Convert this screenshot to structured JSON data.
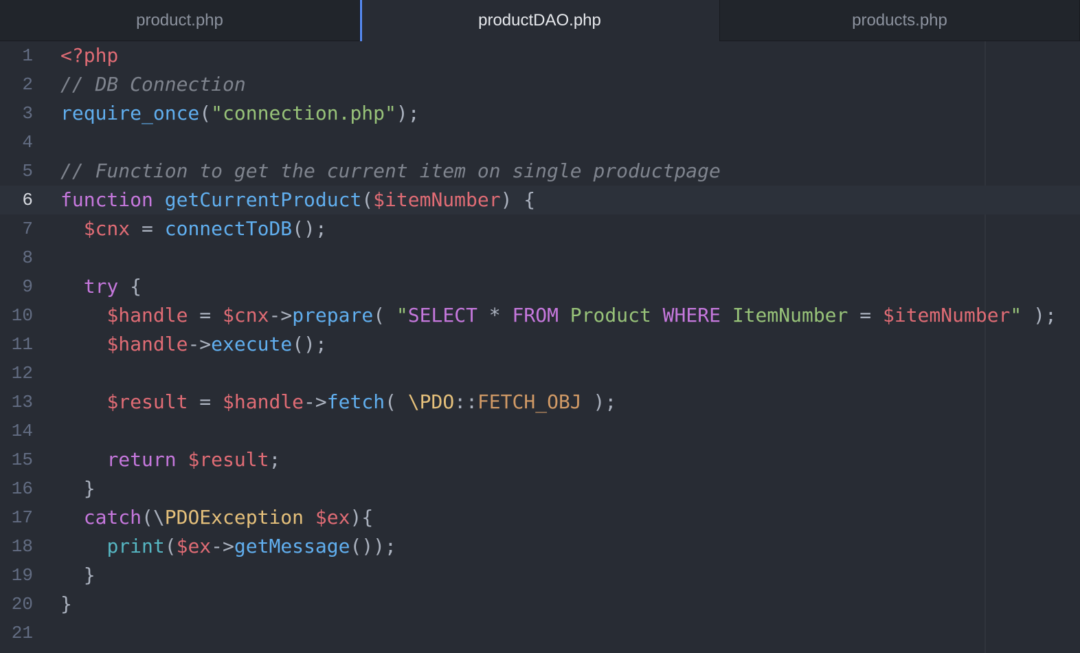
{
  "tabs": [
    {
      "label": "product.php",
      "active": false
    },
    {
      "label": "productDAO.php",
      "active": true
    },
    {
      "label": "products.php",
      "active": false
    }
  ],
  "editor": {
    "cursor_line": 6,
    "lines": [
      {
        "n": "1",
        "tokens": [
          {
            "t": "<?php",
            "c": "tag"
          }
        ]
      },
      {
        "n": "2",
        "tokens": [
          {
            "t": "// DB Connection",
            "c": "comment"
          }
        ]
      },
      {
        "n": "3",
        "tokens": [
          {
            "t": "require_once",
            "c": "func"
          },
          {
            "t": "(",
            "c": "plain"
          },
          {
            "t": "\"connection.php\"",
            "c": "string"
          },
          {
            "t": ");",
            "c": "plain"
          }
        ]
      },
      {
        "n": "4",
        "tokens": []
      },
      {
        "n": "5",
        "tokens": [
          {
            "t": "// Function to get the current item on single productpage",
            "c": "comment"
          }
        ]
      },
      {
        "n": "6",
        "tokens": [
          {
            "t": "function",
            "c": "keyword"
          },
          {
            "t": " ",
            "c": "plain"
          },
          {
            "t": "getCurrentProduct",
            "c": "func"
          },
          {
            "t": "(",
            "c": "plain"
          },
          {
            "t": "$itemNumber",
            "c": "var"
          },
          {
            "t": ") {",
            "c": "plain"
          }
        ]
      },
      {
        "n": "7",
        "tokens": [
          {
            "t": "  ",
            "c": "plain"
          },
          {
            "t": "$cnx",
            "c": "var"
          },
          {
            "t": " = ",
            "c": "plain"
          },
          {
            "t": "connectToDB",
            "c": "func"
          },
          {
            "t": "();",
            "c": "plain"
          }
        ]
      },
      {
        "n": "8",
        "tokens": []
      },
      {
        "n": "9",
        "tokens": [
          {
            "t": "  ",
            "c": "plain"
          },
          {
            "t": "try",
            "c": "keyword"
          },
          {
            "t": " {",
            "c": "plain"
          }
        ]
      },
      {
        "n": "10",
        "tokens": [
          {
            "t": "    ",
            "c": "plain"
          },
          {
            "t": "$handle",
            "c": "var"
          },
          {
            "t": " = ",
            "c": "plain"
          },
          {
            "t": "$cnx",
            "c": "var"
          },
          {
            "t": "->",
            "c": "plain"
          },
          {
            "t": "prepare",
            "c": "func"
          },
          {
            "t": "( ",
            "c": "plain"
          },
          {
            "t": "\"",
            "c": "string"
          },
          {
            "t": "SELECT",
            "c": "keyword"
          },
          {
            "t": " * ",
            "c": "plain"
          },
          {
            "t": "FROM",
            "c": "keyword"
          },
          {
            "t": " Product ",
            "c": "string"
          },
          {
            "t": "WHERE",
            "c": "keyword"
          },
          {
            "t": " ItemNumber ",
            "c": "string"
          },
          {
            "t": "= ",
            "c": "plain"
          },
          {
            "t": "$itemNumber",
            "c": "var"
          },
          {
            "t": "\"",
            "c": "string"
          },
          {
            "t": " );",
            "c": "plain"
          }
        ]
      },
      {
        "n": "11",
        "tokens": [
          {
            "t": "    ",
            "c": "plain"
          },
          {
            "t": "$handle",
            "c": "var"
          },
          {
            "t": "->",
            "c": "plain"
          },
          {
            "t": "execute",
            "c": "func"
          },
          {
            "t": "();",
            "c": "plain"
          }
        ]
      },
      {
        "n": "12",
        "tokens": []
      },
      {
        "n": "13",
        "tokens": [
          {
            "t": "    ",
            "c": "plain"
          },
          {
            "t": "$result",
            "c": "var"
          },
          {
            "t": " = ",
            "c": "plain"
          },
          {
            "t": "$handle",
            "c": "var"
          },
          {
            "t": "->",
            "c": "plain"
          },
          {
            "t": "fetch",
            "c": "func"
          },
          {
            "t": "( ",
            "c": "plain"
          },
          {
            "t": "\\PDO",
            "c": "class"
          },
          {
            "t": "::",
            "c": "plain"
          },
          {
            "t": "FETCH_OBJ",
            "c": "const"
          },
          {
            "t": " );",
            "c": "plain"
          }
        ]
      },
      {
        "n": "14",
        "tokens": []
      },
      {
        "n": "15",
        "tokens": [
          {
            "t": "    ",
            "c": "plain"
          },
          {
            "t": "return",
            "c": "keyword"
          },
          {
            "t": " ",
            "c": "plain"
          },
          {
            "t": "$result",
            "c": "var"
          },
          {
            "t": ";",
            "c": "plain"
          }
        ]
      },
      {
        "n": "16",
        "tokens": [
          {
            "t": "  }",
            "c": "plain"
          }
        ]
      },
      {
        "n": "17",
        "tokens": [
          {
            "t": "  ",
            "c": "plain"
          },
          {
            "t": "catch",
            "c": "keyword"
          },
          {
            "t": "(\\",
            "c": "plain"
          },
          {
            "t": "PDOException",
            "c": "class"
          },
          {
            "t": " ",
            "c": "plain"
          },
          {
            "t": "$ex",
            "c": "var"
          },
          {
            "t": "){",
            "c": "plain"
          }
        ]
      },
      {
        "n": "18",
        "tokens": [
          {
            "t": "    ",
            "c": "plain"
          },
          {
            "t": "print",
            "c": "builtin"
          },
          {
            "t": "(",
            "c": "plain"
          },
          {
            "t": "$ex",
            "c": "var"
          },
          {
            "t": "->",
            "c": "plain"
          },
          {
            "t": "getMessage",
            "c": "func"
          },
          {
            "t": "());",
            "c": "plain"
          }
        ]
      },
      {
        "n": "19",
        "tokens": [
          {
            "t": "  }",
            "c": "plain"
          }
        ]
      },
      {
        "n": "20",
        "tokens": [
          {
            "t": "}",
            "c": "plain"
          }
        ]
      },
      {
        "n": "21",
        "tokens": []
      }
    ]
  },
  "colors": {
    "background": "#282c34",
    "tabbar": "#21252b",
    "active_tab_accent": "#568af2",
    "keyword": "#c678dd",
    "function": "#61afef",
    "string": "#98c379",
    "variable": "#e06c75",
    "comment": "#7f848e",
    "class": "#e5c07b",
    "constant": "#d19a66"
  }
}
